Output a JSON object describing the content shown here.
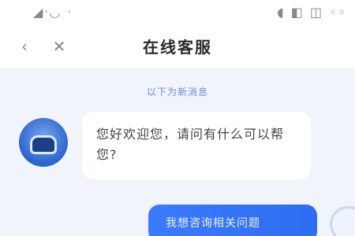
{
  "status_bar": {
    "left_text": "◢ᐧ◡ ᐧ",
    "right_text": "◖ ◧ ◫ ◦◦"
  },
  "header": {
    "back_icon": "back-icon",
    "close_icon": "close-icon",
    "title": "在线客服"
  },
  "chat": {
    "timestamp": "以下为新消息",
    "bot_message": "您好欢迎您，请问有什么可以帮您?",
    "user_message": "我想咨询相关问题"
  },
  "colors": {
    "accent": "#2f6df3",
    "timestamp": "#6b8fd6",
    "background": "#f1f4fa"
  }
}
